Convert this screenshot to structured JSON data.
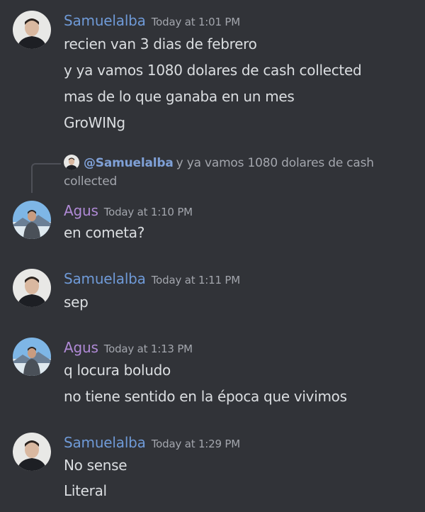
{
  "users": {
    "samuel": {
      "name": "Samuelalba",
      "color": "#6f9ad7",
      "avatar": "person-dark-avatar"
    },
    "agus": {
      "name": "Agus",
      "color": "#b08ad6",
      "avatar": "person-outdoor-avatar"
    }
  },
  "messages": [
    {
      "user": "Samuelalba",
      "time": "Today at 1:01 PM",
      "lines": [
        "recien van 3 dias de febrero",
        "y ya vamos 1080 dolares de cash collected",
        "mas de lo que ganaba en un mes",
        "GroWINg"
      ]
    },
    {
      "reply_to": {
        "mention": "@Samuelalba",
        "preview": "y ya vamos 1080 dolares de cash collected"
      },
      "user": "Agus",
      "time": "Today at 1:10 PM",
      "lines": [
        "en cometa?"
      ]
    },
    {
      "user": "Samuelalba",
      "time": "Today at 1:11 PM",
      "lines": [
        "sep"
      ]
    },
    {
      "user": "Agus",
      "time": "Today at 1:13 PM",
      "lines": [
        "q locura boludo",
        "no tiene sentido en la época que vivimos"
      ]
    },
    {
      "user": "Samuelalba",
      "time": "Today at 1:29 PM",
      "lines": [
        "No sense",
        "Literal"
      ]
    }
  ]
}
